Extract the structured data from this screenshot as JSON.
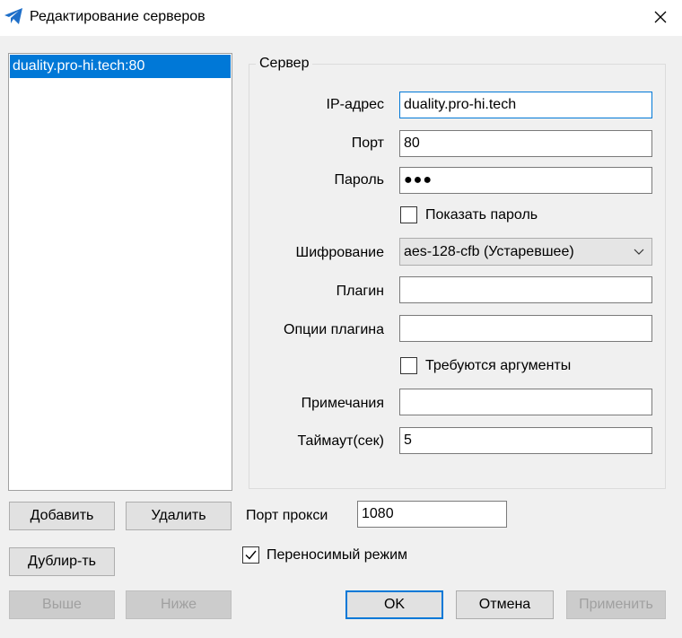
{
  "window": {
    "title": "Редактирование серверов",
    "app_icon": "paper-plane-icon",
    "close_icon": "close-icon"
  },
  "server_list": {
    "items": [
      "duality.pro-hi.tech:80"
    ]
  },
  "server_group": {
    "title": "Сервер",
    "ip_label": "IP-адрес",
    "ip_value": "duality.pro-hi.tech",
    "port_label": "Порт",
    "port_value": "80",
    "password_label": "Пароль",
    "password_value": "●●●",
    "show_password_label": "Показать пароль",
    "encryption_label": "Шифрование",
    "encryption_value": "aes-128-cfb (Устаревшее)",
    "plugin_label": "Плагин",
    "plugin_value": "",
    "plugin_options_label": "Опции плагина",
    "plugin_options_value": "",
    "plugin_args_label": "Требуются аргументы",
    "remarks_label": "Примечания",
    "remarks_value": "",
    "timeout_label": "Таймаут(сек)",
    "timeout_value": "5"
  },
  "buttons": {
    "add": "Добавить",
    "delete": "Удалить",
    "duplicate": "Дублир-ть",
    "up": "Выше",
    "down": "Ниже",
    "ok": "OK",
    "cancel": "Отмена",
    "apply": "Применить"
  },
  "proxy": {
    "port_label": "Порт прокси",
    "port_value": "1080",
    "portable_label": "Переносимый режим",
    "portable_checked": true
  },
  "colors": {
    "accent": "#0078d7",
    "dialog_bg": "#f0f0f0"
  }
}
